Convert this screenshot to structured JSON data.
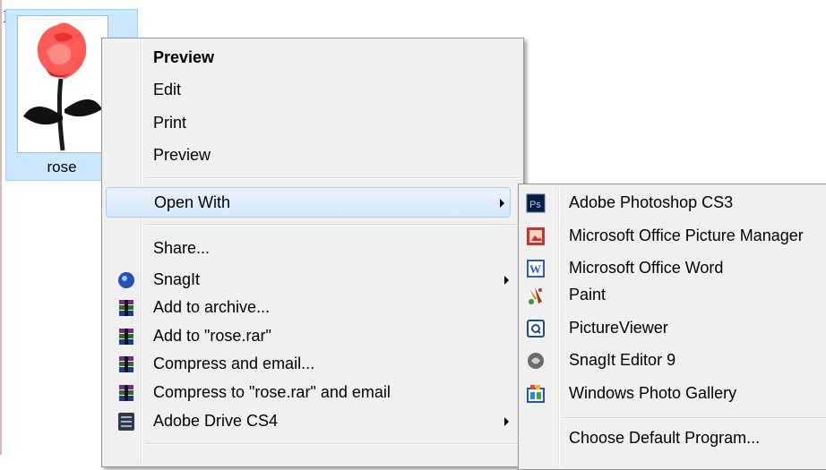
{
  "file": {
    "name": "rose"
  },
  "context_menu": {
    "items": [
      {
        "label": "Preview",
        "bold": true
      },
      {
        "label": "Edit"
      },
      {
        "label": "Print"
      },
      {
        "label": "Preview"
      },
      {
        "label": "Open With",
        "has_submenu": true,
        "highlighted": true
      },
      {
        "label": "Share..."
      },
      {
        "label": "SnagIt",
        "icon": "snagit-icon",
        "has_submenu": true
      },
      {
        "label": "Add to archive...",
        "icon": "winrar-icon"
      },
      {
        "label": "Add to \"rose.rar\"",
        "icon": "winrar-icon"
      },
      {
        "label": "Compress and email...",
        "icon": "winrar-icon"
      },
      {
        "label": "Compress to \"rose.rar\" and email",
        "icon": "winrar-icon"
      },
      {
        "label": "Adobe Drive CS4",
        "icon": "adobe-drive-icon",
        "has_submenu": true
      }
    ]
  },
  "open_with_submenu": {
    "items": [
      {
        "label": "Adobe Photoshop CS3",
        "icon": "photoshop-icon"
      },
      {
        "label": "Microsoft Office Picture Manager",
        "icon": "picture-manager-icon"
      },
      {
        "label": "Microsoft Office Word",
        "icon": "word-icon"
      },
      {
        "label": "Paint",
        "icon": "paint-icon"
      },
      {
        "label": "PictureViewer",
        "icon": "pictureviewer-icon"
      },
      {
        "label": "SnagIt Editor 9",
        "icon": "snagit-editor-icon"
      },
      {
        "label": "Windows Photo Gallery",
        "icon": "photo-gallery-icon"
      },
      {
        "label": "Choose Default Program..."
      }
    ]
  },
  "colors": {
    "menu_bg": "#f0f0f0",
    "highlight": "#d5e8fb",
    "selection": "#cce8ff"
  }
}
